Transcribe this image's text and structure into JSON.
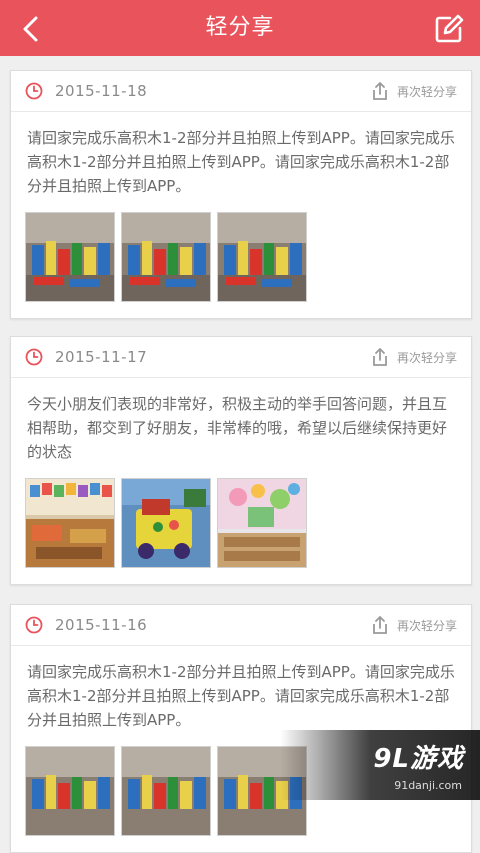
{
  "header": {
    "title": "轻分享"
  },
  "posts": [
    {
      "date": "2015-11-18",
      "share_label": "再次轻分享",
      "text": "请回家完成乐高积木1-2部分并且拍照上传到APP。请回家完成乐高积木1-2部分并且拍照上传到APP。请回家完成乐高积木1-2部分并且拍照上传到APP。",
      "images": [
        "lego-photo",
        "lego-photo",
        "lego-photo"
      ]
    },
    {
      "date": "2015-11-17",
      "share_label": "再次轻分享",
      "text": "今天小朋友们表现的非常好，积极主动的举手回答问题，并且互相帮助，都交到了好朋友，非常棒的哦，希望以后继续保持更好的状态",
      "images": [
        "classroom-photo",
        "toy-photo",
        "mural-photo"
      ]
    },
    {
      "date": "2015-11-16",
      "share_label": "再次轻分享",
      "text": "请回家完成乐高积木1-2部分并且拍照上传到APP。请回家完成乐高积木1-2部分并且拍照上传到APP。请回家完成乐高积木1-2部分并且拍照上传到APP。",
      "images": [
        "lego-photo",
        "lego-photo",
        "lego-photo"
      ]
    }
  ],
  "watermark": {
    "brand": "9L游戏",
    "site": "91danji.com"
  },
  "colors": {
    "accent": "#e9535c"
  }
}
